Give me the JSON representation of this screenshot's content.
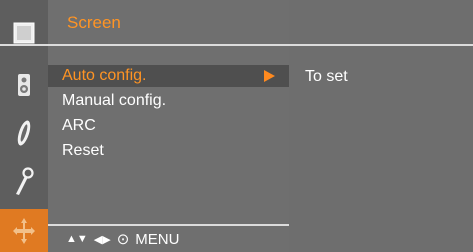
{
  "menu": {
    "title": "Screen",
    "items": [
      {
        "label": "Auto config.",
        "selected": true
      },
      {
        "label": "Manual config.",
        "selected": false
      },
      {
        "label": "ARC",
        "selected": false
      },
      {
        "label": "Reset",
        "selected": false
      }
    ],
    "nav": {
      "updown_glyph": "▲▼",
      "leftright_glyph": "◀▶",
      "enter_glyph": "⊙",
      "menu_label": "MENU"
    }
  },
  "submenu": {
    "hint": "To set"
  },
  "sidebar": {
    "icons": [
      "picture-icon",
      "audio-speaker-icon",
      "tracking-icon",
      "setup-icon",
      "screen-position-icon"
    ],
    "active_index": 4
  },
  "colors": {
    "accent": "#ff9424",
    "background": "#6f6f6f",
    "active_tab": "#e07a22"
  }
}
